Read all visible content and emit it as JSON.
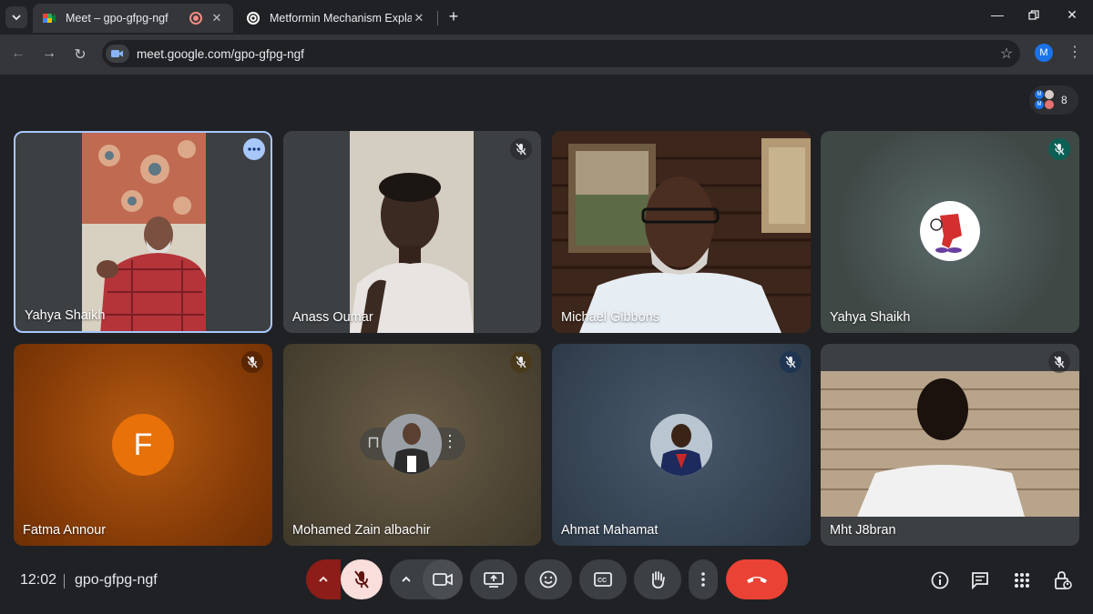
{
  "browser": {
    "tabs": [
      {
        "title": "Meet – gpo-gfpg-ngf",
        "active": true,
        "recording": true
      },
      {
        "title": "Metformin Mechanism Explaine",
        "active": false
      }
    ],
    "url": "meet.google.com/gpo-gfpg-ngf",
    "profile_initial": "M"
  },
  "meet": {
    "participant_count": "8",
    "participant_chip_initials": [
      "M",
      "M"
    ],
    "tiles": [
      {
        "name": "Yahya Shaikh",
        "muted": false,
        "selected": true
      },
      {
        "name": "Anass Oumar",
        "muted": true
      },
      {
        "name": "Michael Gibbons",
        "muted": false
      },
      {
        "name": "Yahya Shaikh",
        "muted": true
      },
      {
        "name": "Fatma Annour",
        "muted": true,
        "avatar_letter": "F"
      },
      {
        "name": "Mohamed Zain albachir",
        "muted": true
      },
      {
        "name": "Ahmat Mahamat",
        "muted": true
      },
      {
        "name": "Mht J8bran",
        "muted": true
      }
    ],
    "colors": {
      "accent_blue": "#a8c7fa",
      "end_call_red": "#ea4335",
      "mic_off_bg": "#f9dedc",
      "fatma_avatar": "#e8710a"
    }
  },
  "bottom_bar": {
    "time": "12:02",
    "meeting_code": "gpo-gfpg-ngf",
    "controls": [
      "mic-options",
      "mic-off",
      "camera-options",
      "camera",
      "present-screen",
      "emoji-reactions",
      "captions",
      "raise-hand",
      "more-options",
      "leave-call"
    ],
    "right_controls": [
      "meeting-details",
      "chat",
      "activities",
      "host-controls"
    ]
  }
}
